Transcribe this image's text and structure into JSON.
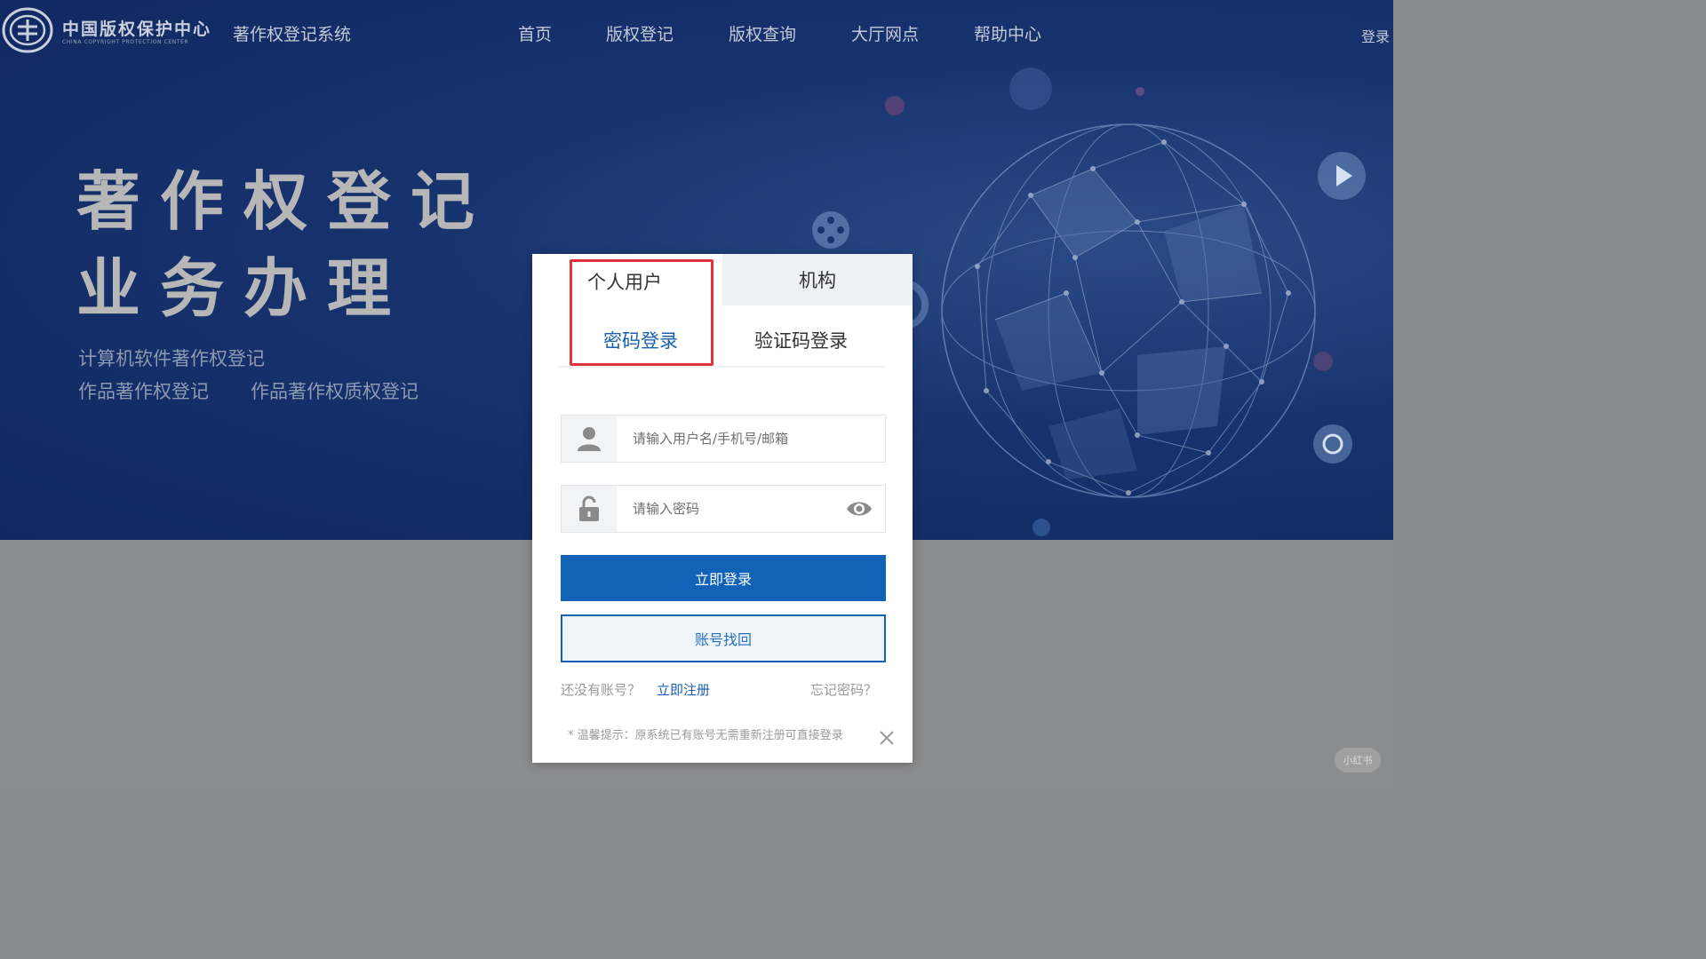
{
  "header": {
    "logo_cn": "中国版权保护中心",
    "logo_en": "CHINA COPYRIGHT PROTECTION CENTER",
    "system_name": "著作权登记系统",
    "nav": [
      "首页",
      "版权登记",
      "版权查询",
      "大厅网点",
      "帮助中心"
    ],
    "login": "登录"
  },
  "hero": {
    "title_line1": "著作权登记",
    "title_line2": "业务办理",
    "sub1": "计算机软件著作权登记",
    "sub2a": "作品著作权登记",
    "sub2b": "作品著作权质权登记"
  },
  "login_card": {
    "tab_person": "个人用户",
    "tab_org": "机构",
    "mode_password": "密码登录",
    "mode_code": "验证码登录",
    "username_placeholder": "请输入用户名/手机号/邮箱",
    "password_placeholder": "请输入密码",
    "login_button": "立即登录",
    "recover_button": "账号找回",
    "no_account": "还没有账号？",
    "register": "立即注册",
    "forgot": "忘记密码？",
    "tip": "* 温馨提示：原系统已有账号无需重新注册可直接登录"
  },
  "watermark": "小红书",
  "colors": {
    "primary": "#1262b8",
    "highlight_border": "#e3323a",
    "hero_bg": "#17336e"
  }
}
